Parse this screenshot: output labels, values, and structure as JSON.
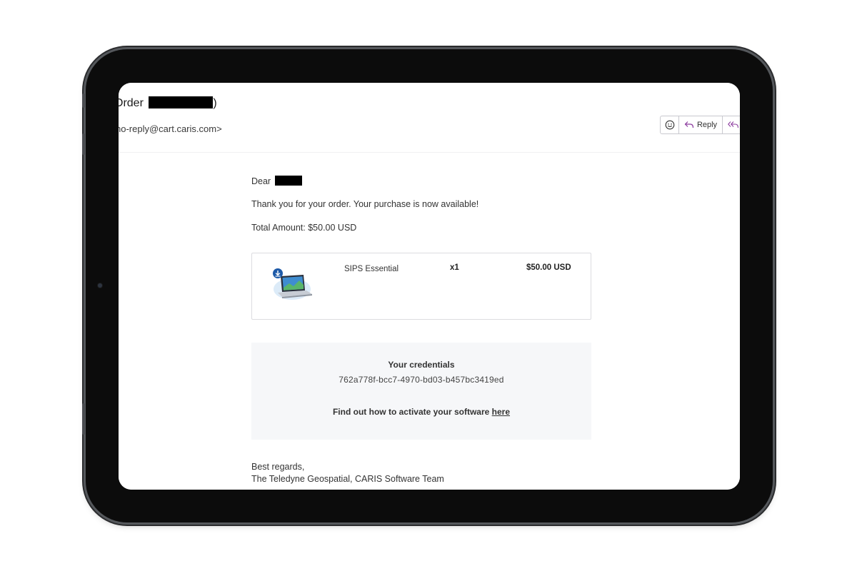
{
  "email": {
    "subject_prefix": "Order",
    "subject_suffix": ")",
    "sender": "no-reply@cart.caris.com>",
    "actions": {
      "emoji_icon": "smiley-icon",
      "reply_label": "Reply",
      "reply_icon": "reply-arrow-icon",
      "reply_all_icon": "reply-all-arrow-icon"
    }
  },
  "body": {
    "greeting": "Dear",
    "thanks": "Thank you for your order. Your purchase is now available!",
    "total": "Total Amount: $50.00 USD",
    "order_item": {
      "image_icon": "laptop-download-icon",
      "name": "SIPS Essential",
      "quantity": "x1",
      "price": "$50.00 USD"
    },
    "credentials": {
      "title": "Your credentials",
      "code": "762a778f-bcc7-4970-bd03-b457bc3419ed",
      "activate_text": "Find out how to activate your software ",
      "activate_link": "here"
    },
    "signoff": "Best regards,",
    "team": "The Teledyne Geospatial, CARIS Software Team"
  },
  "colors": {
    "accent": "#8b3a9e",
    "bezel": "#0c0c0c",
    "background": "#ffffff"
  }
}
